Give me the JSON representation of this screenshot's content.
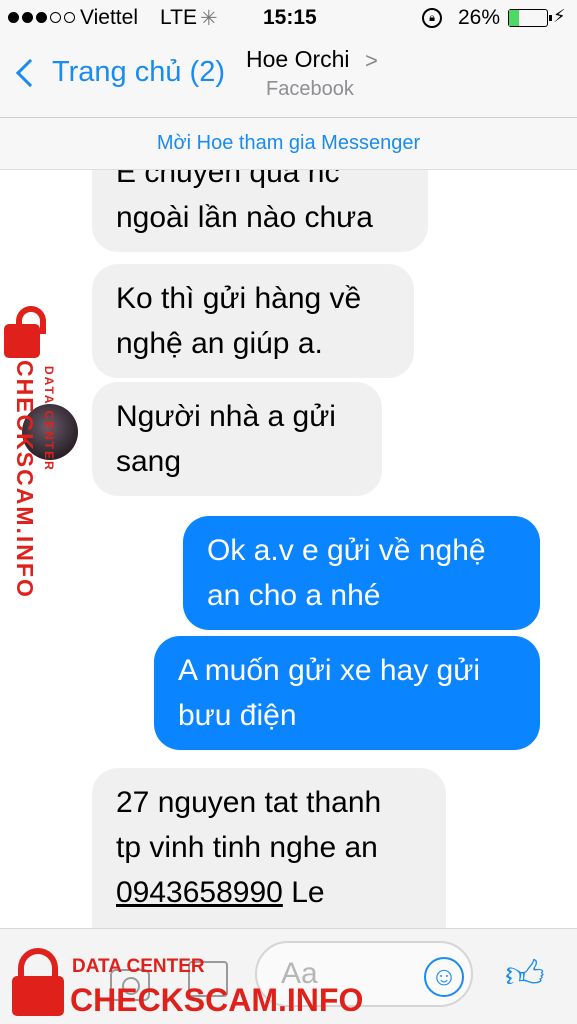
{
  "status_bar": {
    "carrier": "Viettel",
    "network": "LTE",
    "time": "15:15",
    "battery_percent": "26%",
    "battery_level": 0.26
  },
  "nav": {
    "back_label": "Trang chủ (2)",
    "title": "Hoe Orchi",
    "subtitle": "Facebook"
  },
  "invite_banner": "Mời Hoe tham gia Messenger",
  "messages": [
    {
      "direction": "incoming",
      "text": "E chuyển qua nc\nngoài lần nào chưa"
    },
    {
      "direction": "incoming",
      "text": "Ko thì gửi hàng về\nnghệ an giúp a."
    },
    {
      "direction": "incoming",
      "text": "Người nhà a gửi\nsang"
    },
    {
      "direction": "outgoing",
      "text": "Ok a.v e gửi về nghệ\nan cho a nhé"
    },
    {
      "direction": "outgoing",
      "text": "A muốn gửi xe hay gửi\nbưu điện"
    },
    {
      "direction": "incoming",
      "text_line1": "27 nguyen tat thanh",
      "text_line2": "tp vinh tinh nghe an",
      "phone": "0943658990",
      "text_after_phone": " Le"
    }
  ],
  "composer": {
    "placeholder": "Aa"
  },
  "watermark": {
    "brand": "CHECKSCAM.INFO",
    "tagline": "DATA CENTER"
  },
  "colors": {
    "accent": "#1a8cf0",
    "outgoing_bubble": "#0a84ff",
    "incoming_bubble": "#f1f0f0",
    "watermark_red": "#e0201a"
  }
}
